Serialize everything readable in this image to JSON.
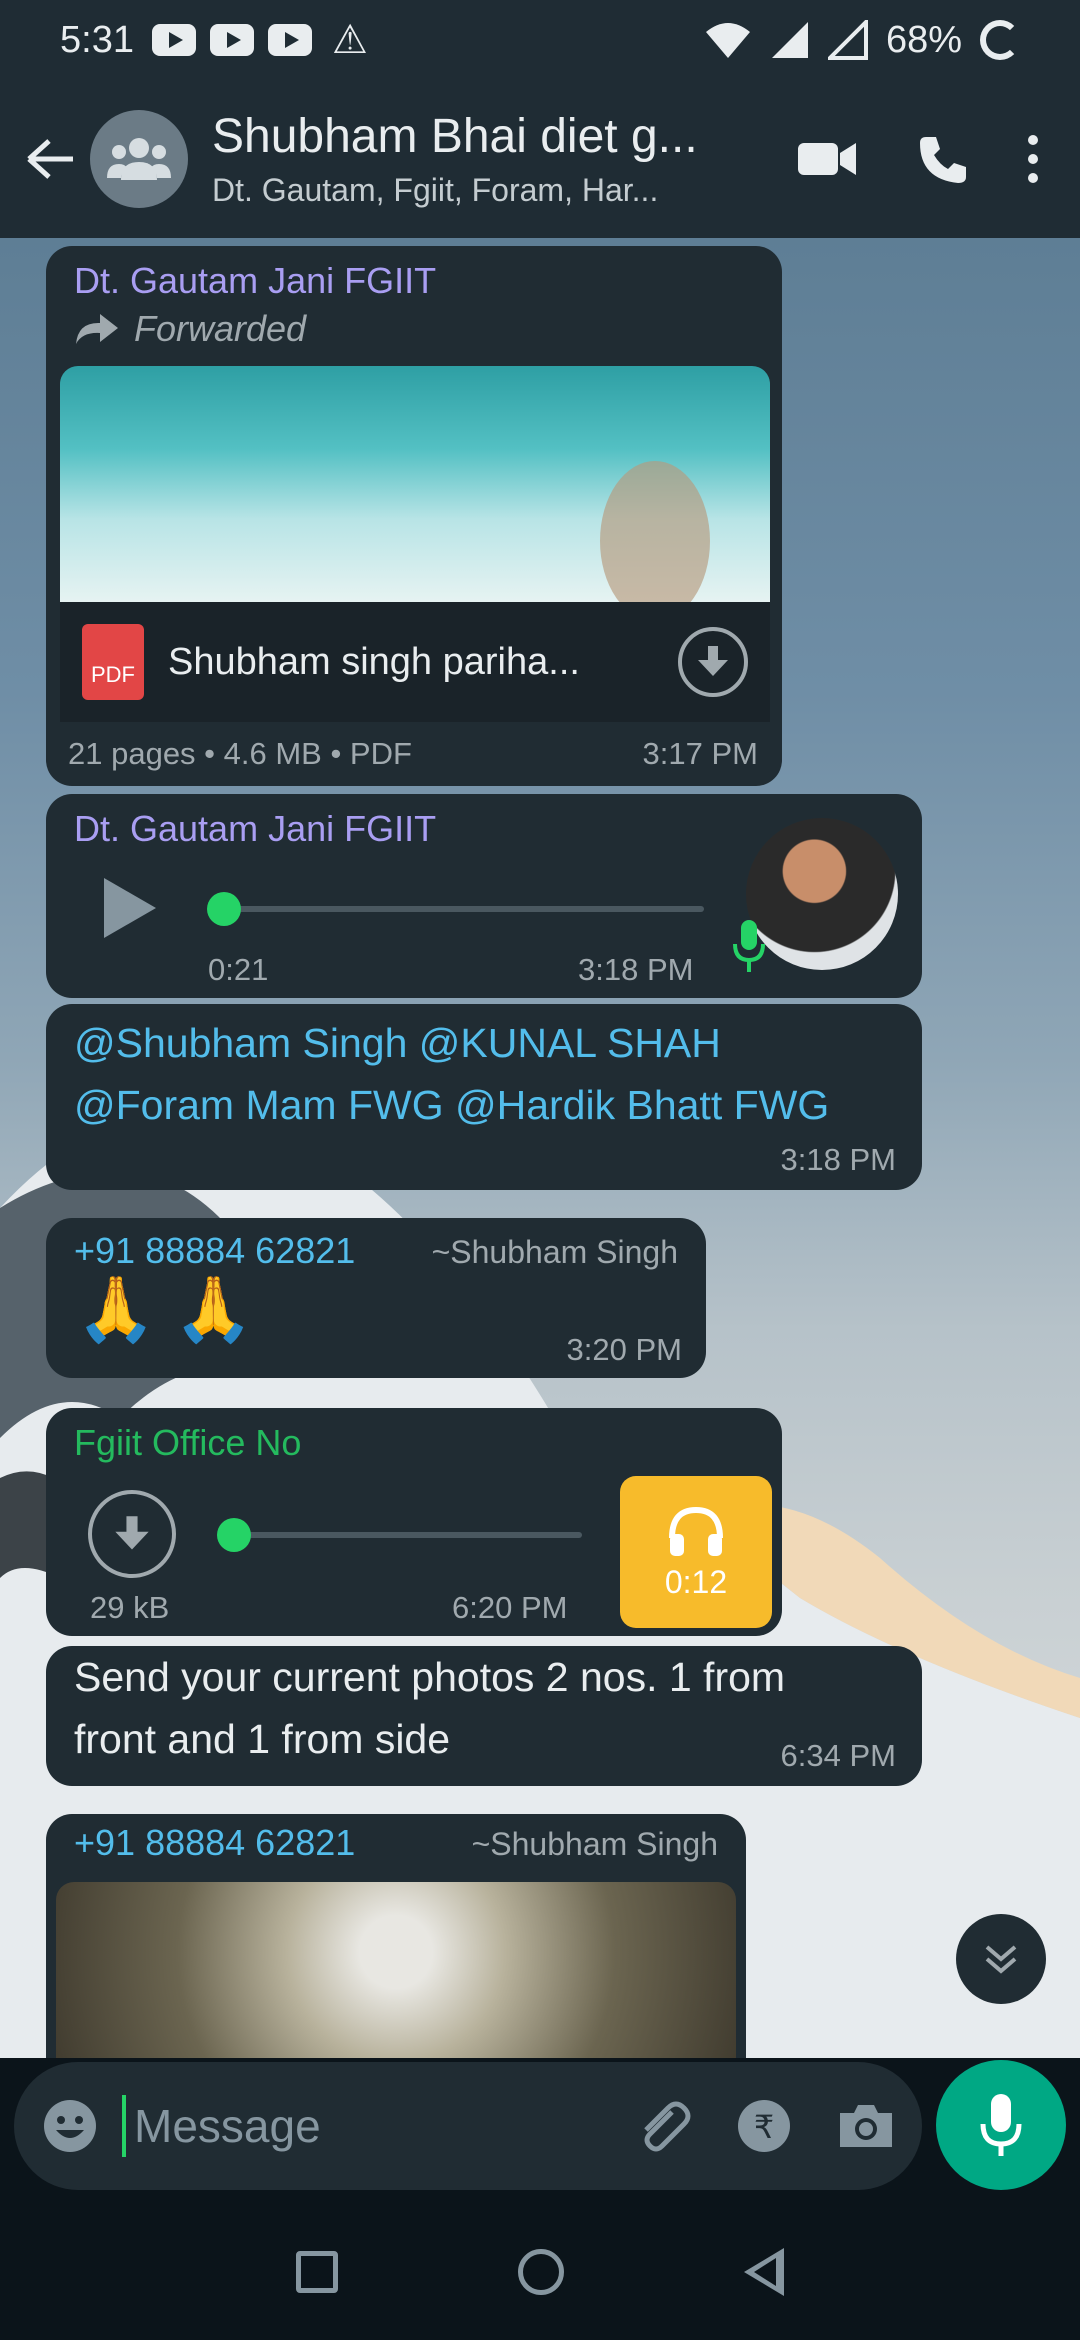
{
  "status_bar": {
    "time": "5:31",
    "battery": "68%",
    "notification_icons": [
      "youtube-icon",
      "youtube-icon",
      "youtube-icon",
      "warning-icon"
    ]
  },
  "header": {
    "title": "Shubham Bhai diet g...",
    "subtitle": "Dt. Gautam, Fgiit, Foram, Har..."
  },
  "messages": {
    "doc": {
      "sender": "Dt. Gautam Jani FGIIT",
      "forwarded": "Forwarded",
      "file_name": "Shubham singh pariha...",
      "file_icon_text": "PDF",
      "meta": "21 pages • 4.6 MB • PDF",
      "time": "3:17 PM"
    },
    "voice1": {
      "sender": "Dt. Gautam Jani FGIIT",
      "duration": "0:21",
      "time": "3:18 PM",
      "progress": 0.0
    },
    "mentions": {
      "line1": "@Shubham Singh @KUNAL SHAH",
      "line2": "@Foram Mam FWG @Hardik Bhatt FWG",
      "time": "3:18 PM"
    },
    "emoji_msg": {
      "sender_number": "+91 88884 62821",
      "sender_name": "~Shubham Singh",
      "text": "🙏 🙏",
      "time": "3:20 PM"
    },
    "voice2": {
      "sender": "Fgiit Office No",
      "size": "29 kB",
      "time": "6:20 PM",
      "badge_duration": "0:12",
      "progress": 0.0
    },
    "text_msg": {
      "line1": "Send your current photos 2 nos. 1 from",
      "line2": "front and 1 from side",
      "time": "6:34 PM"
    },
    "image_msg": {
      "sender_number": "+91 88884 62821",
      "sender_name": "~Shubham Singh"
    }
  },
  "composer": {
    "placeholder": "Message"
  },
  "colors": {
    "accent_green": "#00a884",
    "bubble": "#202c33",
    "header": "#1f2c34",
    "sender_purple": "#a99ef2",
    "mention_blue": "#53bdeb",
    "audio_badge": "#f7bb2b"
  }
}
